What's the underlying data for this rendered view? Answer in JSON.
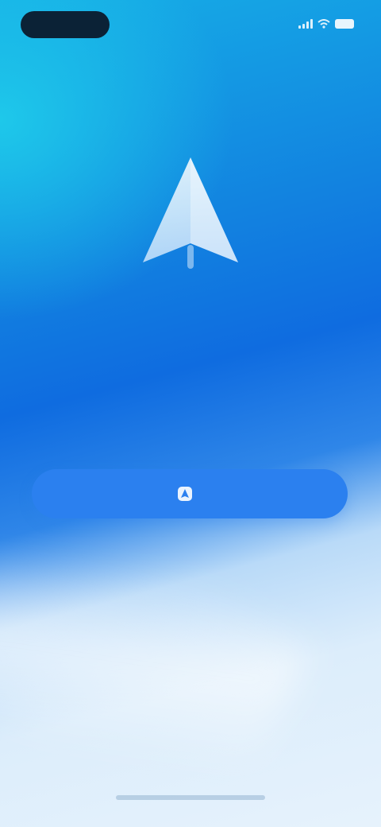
{
  "status_bar": {
    "time": "",
    "icons": [
      "signal-icon",
      "wifi-icon",
      "battery-icon"
    ]
  },
  "hero": {
    "icon": "paper-plane-icon"
  },
  "content": {
    "title": "",
    "subtitle": ""
  },
  "cta": {
    "label": "",
    "icon": "app-logo-icon"
  },
  "footer": {
    "text": ""
  },
  "colors": {
    "accent": "#2b80ef",
    "gradient_top": "#16aee6",
    "gradient_mid": "#0f6ce0",
    "gradient_bottom": "#e6f2fc",
    "status_pill": "#0b2236"
  }
}
